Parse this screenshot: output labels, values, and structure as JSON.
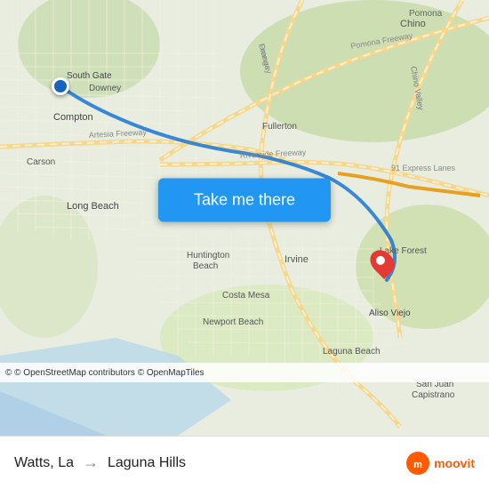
{
  "map": {
    "attribution": "© OpenStreetMap contributors © OpenMapTiles",
    "center_lat": 33.8,
    "center_lng": -117.9
  },
  "button": {
    "label": "Take me there"
  },
  "footer": {
    "origin": "Watts, La",
    "destination": "Laguna Hills",
    "arrow": "→"
  },
  "logo": {
    "text": "moovit"
  },
  "places": {
    "chino": "Chino",
    "pomona": "Pomona",
    "south_gate": "South Gate",
    "downey": "Downey",
    "compton": "Compton",
    "carson": "Carson",
    "long_beach": "Long Beach",
    "fullerton": "Fullerton",
    "huntington_beach": "Huntington Beach",
    "costa_mesa": "Costa Mesa",
    "newport_beach": "Newport Beach",
    "irvine": "Irvine",
    "lake_forest": "Lake Forest",
    "aliso_viejo": "Aliso Viejo",
    "laguna_beach": "Laguna Beach",
    "san_juan_capistrano": "San Juan Capistrano"
  },
  "roads": {
    "pomona_freeway": "Pomona Freeway",
    "chino_valley_freeway": "Chino Valley Freeway",
    "orange_freeway": "Orange Freeway",
    "artesia_freeway": "Artesia Freeway",
    "riverside_freeway": "Riverside Freeway",
    "express_lanes_91": "91 Express Lanes"
  },
  "colors": {
    "map_bg": "#e8f0e0",
    "button_bg": "#2196F3",
    "button_text": "#ffffff",
    "footer_bg": "#ffffff",
    "origin_pin": "#1565C0",
    "dest_pin": "#e53935",
    "road_color": "#f5deb3",
    "freeway_color": "#ffa500",
    "water_color": "#b3d9f0",
    "text_color": "#333333",
    "moovit_color": "#ff5a00"
  }
}
